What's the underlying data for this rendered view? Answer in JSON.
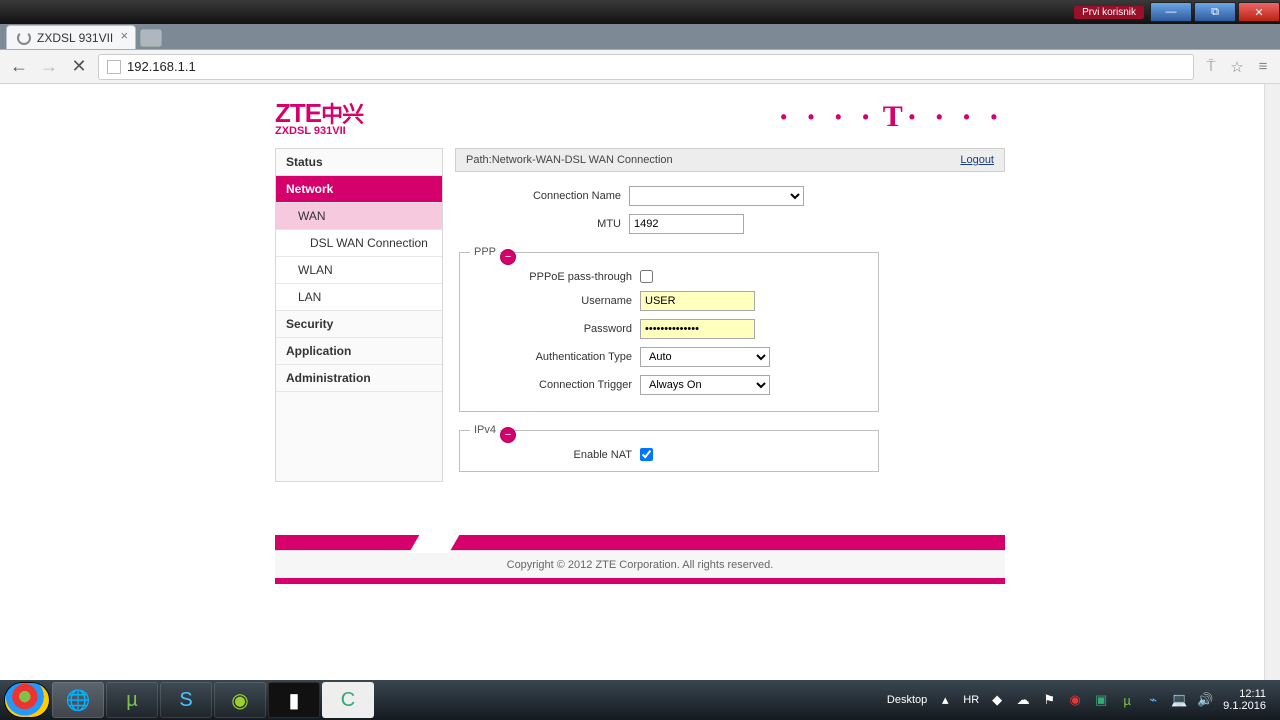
{
  "window": {
    "tag": "Prvi korisnik"
  },
  "tab": {
    "title": "ZXDSL 931VII"
  },
  "url": "192.168.1.1",
  "brand": {
    "logo": "ZTE",
    "cjk": "中兴",
    "model": "ZXDSL 931VII"
  },
  "sidebar": {
    "items": [
      {
        "label": "Status"
      },
      {
        "label": "Network"
      },
      {
        "label": "WAN"
      },
      {
        "label": "DSL WAN Connection"
      },
      {
        "label": "WLAN"
      },
      {
        "label": "LAN"
      },
      {
        "label": "Security"
      },
      {
        "label": "Application"
      },
      {
        "label": "Administration"
      }
    ]
  },
  "path": {
    "prefix": "Path:",
    "value": "Network-WAN-DSL WAN Connection",
    "logout": "Logout"
  },
  "form": {
    "conn_name_label": "Connection Name",
    "conn_name_value": "",
    "mtu_label": "MTU",
    "mtu_value": "1492",
    "ppp_legend": "PPP",
    "pppoe_pt_label": "PPPoE pass-through",
    "username_label": "Username",
    "username_value": "USER",
    "password_label": "Password",
    "password_value": "••••••••••••••",
    "auth_label": "Authentication Type",
    "auth_value": "Auto",
    "trigger_label": "Connection Trigger",
    "trigger_value": "Always On",
    "ipv4_legend": "IPv4",
    "nat_label": "Enable NAT"
  },
  "footer": {
    "copyright": "Copyright © 2012 ZTE Corporation. All rights reserved."
  },
  "taskbar": {
    "desktop": "Desktop",
    "lang": "HR",
    "time": "12:11",
    "date": "9.1.2016"
  }
}
